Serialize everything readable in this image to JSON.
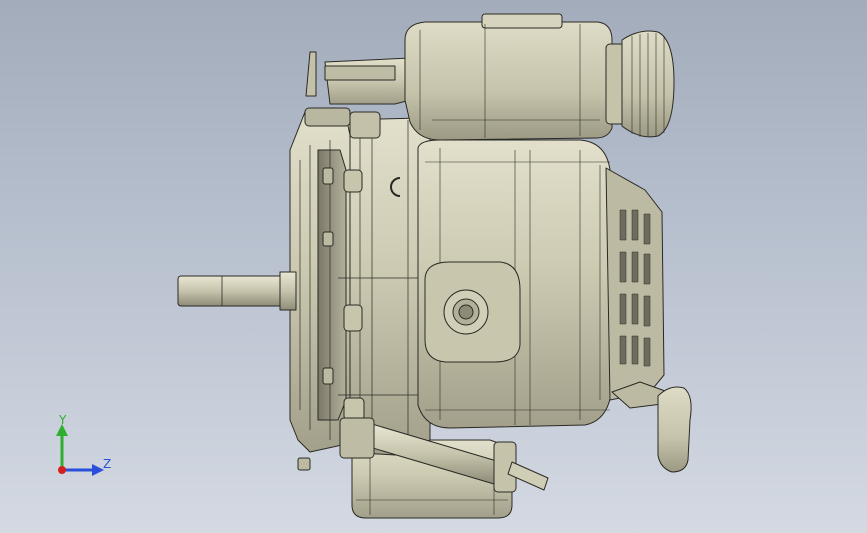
{
  "viewport": {
    "background_top": "#a3acbb",
    "background_bottom": "#d4d9e2"
  },
  "model": {
    "body_color": "#cdcab2",
    "shadow_color": "#8f8c78",
    "edge_color": "#2a2a24"
  },
  "triad": {
    "y_label": "Y",
    "z_label": "Z",
    "y_color": "#2fae2f",
    "z_color": "#2b4fd8",
    "x_color": "#d21f1f"
  }
}
